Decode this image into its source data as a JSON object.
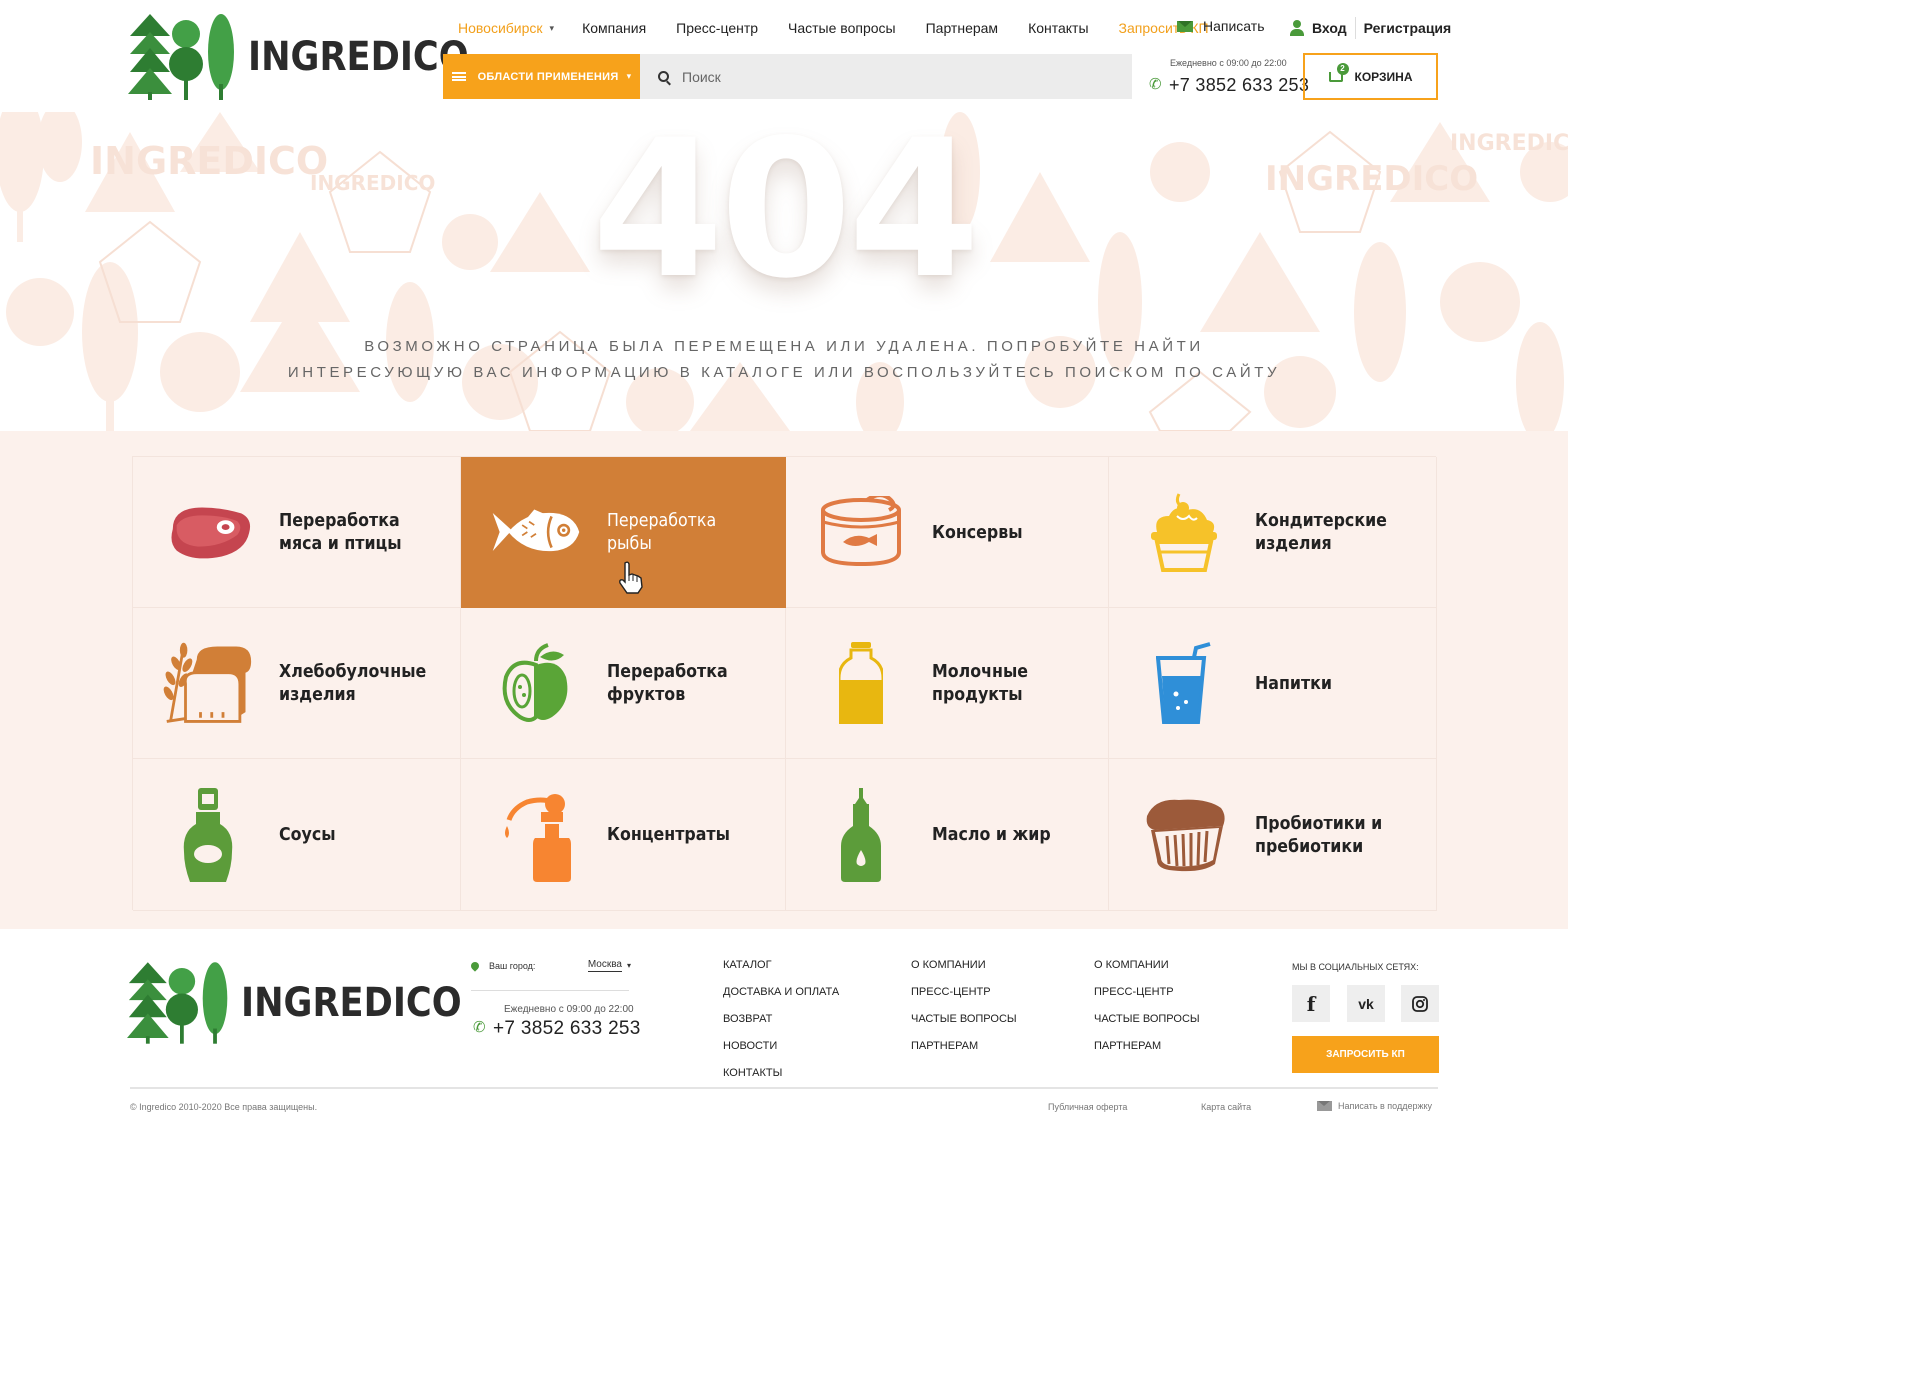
{
  "header": {
    "logo_text": "INGREDICO",
    "city": "Новосибирск",
    "nav": [
      "Компания",
      "Пресс-центр",
      "Частые вопросы",
      "Партнерам",
      "Контакты"
    ],
    "request_quote": "Запросить КП",
    "write": "Написать",
    "login": "Вход",
    "register": "Регистрация",
    "areas_button": "ОБЛАСТИ ПРИМЕНЕНИЯ",
    "search_placeholder": "Поиск",
    "hours": "Ежедневно с 09:00 до 22:00",
    "phone": "+7 3852 633 253",
    "cart_label": "КОРЗИНА",
    "cart_count": "2"
  },
  "hero": {
    "code": "404",
    "line1": "Возможно страница была перемещена или удалена. Попробуйте найти",
    "line2": "интересующую вас информацию в каталоге или воспользуйтесь поиском по сайту"
  },
  "categories": [
    {
      "label": "Переработка мяса и птицы",
      "icon": "meat-steak-icon",
      "color": "#c5454f"
    },
    {
      "label": "Переработка рыбы",
      "icon": "fish-icon",
      "color": "#ffffff",
      "active": true
    },
    {
      "label": "Консервы",
      "icon": "canned-food-icon",
      "color": "#e07a44"
    },
    {
      "label": "Кондитерские изделия",
      "icon": "cake-icon",
      "color": "#f6c229"
    },
    {
      "label": "Хлебобулочные изделия",
      "icon": "bread-wheat-icon",
      "color": "#d17f37"
    },
    {
      "label": "Переработка фруктов",
      "icon": "apple-icon",
      "color": "#5aa537"
    },
    {
      "label": "Молочные продукты",
      "icon": "milk-bottle-icon",
      "color": "#e8b710"
    },
    {
      "label": "Напитки",
      "icon": "drink-glass-icon",
      "color": "#2f8fd8"
    },
    {
      "label": "Соусы",
      "icon": "sauce-bottle-icon",
      "color": "#5c9c3a"
    },
    {
      "label": "Концентраты",
      "icon": "dropper-bottle-icon",
      "color": "#f78531"
    },
    {
      "label": "Масло и жир",
      "icon": "oil-bottle-icon",
      "color": "#5c9c3a"
    },
    {
      "label": "Пробиотики и пребиотики",
      "icon": "probiotic-cup-icon",
      "color": "#9c5a3a"
    }
  ],
  "footer": {
    "logo_text": "INGREDICO",
    "city_label": "Ваш город:",
    "city_value": "Москва",
    "hours": "Ежедневно с 09:00 до 22:00",
    "phone": "+7 3852 633 253",
    "col1": [
      "Каталог",
      "Доставка и оплата",
      "Возврат",
      "Новости",
      "Контакты"
    ],
    "col2": [
      "О компании",
      "Пресс-центр",
      "Частые вопросы",
      "Партнерам"
    ],
    "col3": [
      "О компании",
      "Пресс-центр",
      "Частые вопросы",
      "Партнерам"
    ],
    "social_title": "Мы в социальных сетях:",
    "social": [
      "f",
      "vk",
      "ig"
    ],
    "request_quote": "Запросить КП",
    "copyright": "© Ingredico 2010-2020 Все права защищены.",
    "offer": "Публичная оферта",
    "sitemap": "Карта сайта",
    "support": "Написать в поддержку"
  }
}
